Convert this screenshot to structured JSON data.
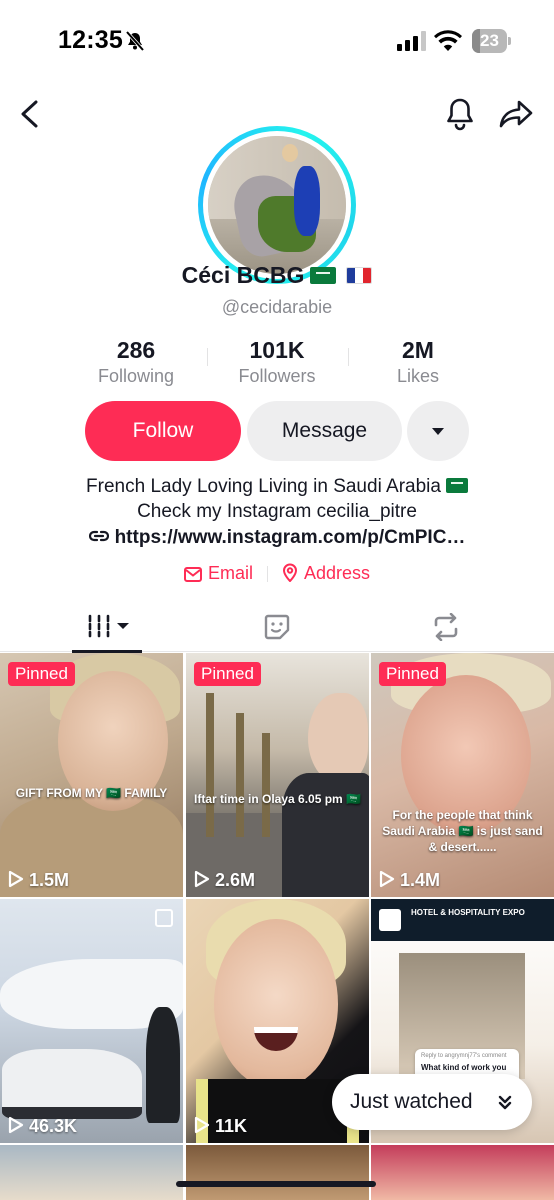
{
  "status_bar": {
    "time": "12:35",
    "battery": "23",
    "battery_fraction": 0.23
  },
  "header": {
    "back_icon": "chevron-left-icon",
    "bell_icon": "bell-icon",
    "share_icon": "share-arrow-icon"
  },
  "profile": {
    "display_name": "Céci BCBG",
    "username": "@cecidarabie",
    "flags": [
      "saudi-arabia-flag",
      "france-flag"
    ]
  },
  "stats": {
    "following_count": "286",
    "following_label": "Following",
    "followers_count": "101K",
    "followers_label": "Followers",
    "likes_count": "2M",
    "likes_label": "Likes"
  },
  "actions": {
    "follow_label": "Follow",
    "message_label": "Message"
  },
  "bio": {
    "line1": "French Lady Loving Living in Saudi Arabia",
    "line2": "Check my Instagram cecilia_pitre",
    "link": "https://www.instagram.com/p/CmPIC…",
    "email_label": "Email",
    "address_label": "Address"
  },
  "tabs": [
    "videos-grid",
    "favorites",
    "reposts"
  ],
  "grid": {
    "tiles": [
      {
        "pinned": "Pinned",
        "views": "1.5M",
        "caption": "GIFT FROM MY 🇸🇦 FAMILY"
      },
      {
        "pinned": "Pinned",
        "views": "2.6M",
        "caption": "Iftar time in Olaya 6.05 pm 🇸🇦"
      },
      {
        "pinned": "Pinned",
        "views": "1.4M",
        "caption": "For the people that think Saudi Arabia 🇸🇦 is just sand & desert......"
      },
      {
        "views": "46.3K"
      },
      {
        "views": "11K"
      },
      {
        "header_text": "HOTEL & HOSPITALITY EXPO",
        "bubble_small": "Reply to angrymnj77's comment",
        "bubble_text": "What kind of work you do ?"
      }
    ]
  },
  "floating": {
    "just_watched_label": "Just watched"
  },
  "colors": {
    "accent": "#fe2c55",
    "text": "#161823",
    "muted": "#8a8b91",
    "ring": "#25f4ee"
  }
}
